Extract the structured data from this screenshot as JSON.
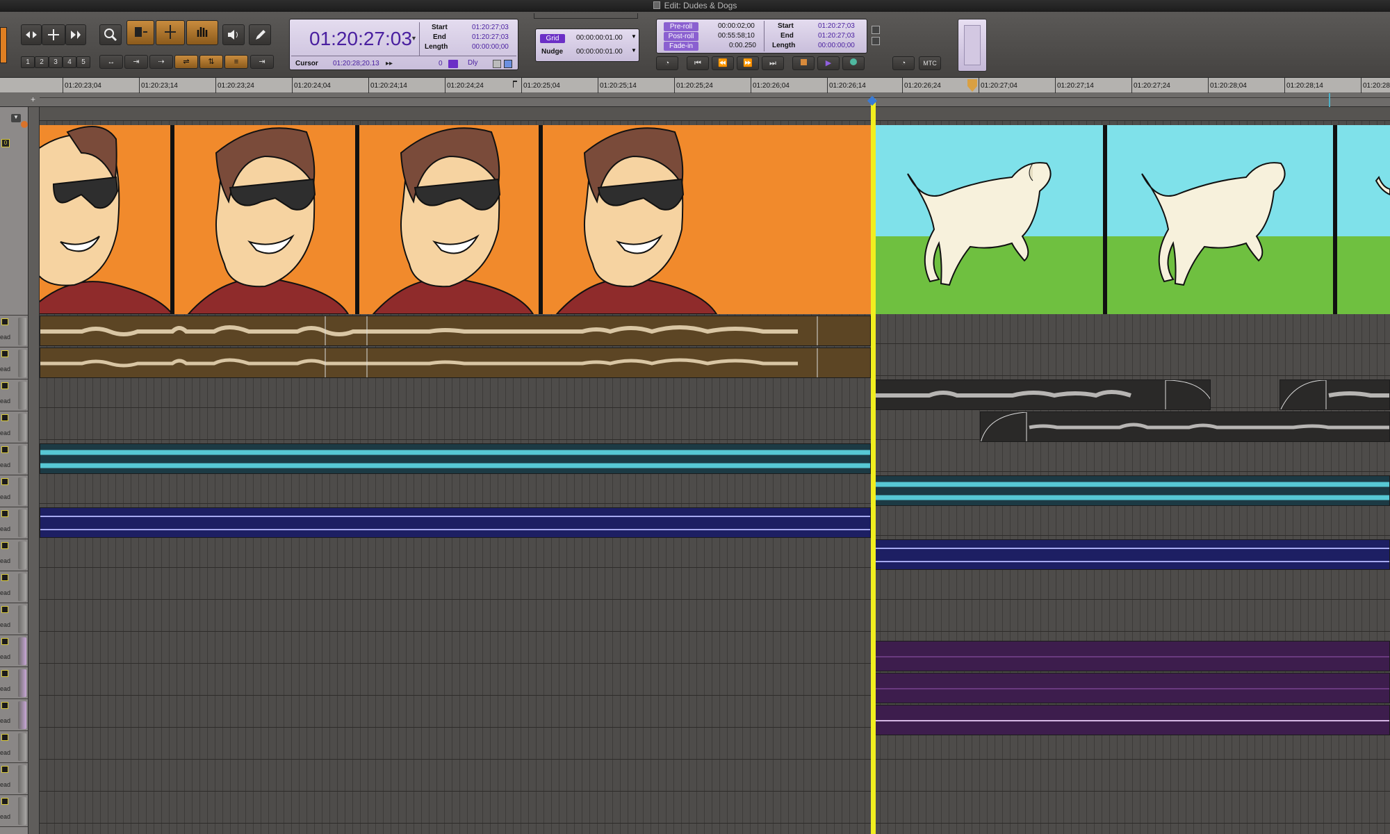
{
  "window": {
    "title": "Edit: Dudes & Dogs"
  },
  "toolbar": {
    "edit_mode_numbers": [
      "1",
      "2",
      "3",
      "4",
      "5"
    ],
    "main_counter": "01:20:27:03",
    "selection": {
      "start_label": "Start",
      "start_value": "01:20:27;03",
      "end_label": "End",
      "end_value": "01:20:27;03",
      "length_label": "Length",
      "length_value": "00:00:00;00"
    },
    "cursor": {
      "label": "Cursor",
      "value": "01:20:28;20.13",
      "count": "0",
      "dly_label": "Dly"
    },
    "grid": {
      "label": "Grid",
      "value": "00:00:00:01.00"
    },
    "nudge": {
      "label": "Nudge",
      "value": "00:00:00:01.00"
    },
    "preroll": {
      "label": "Pre-roll",
      "value": "00:00:02;00"
    },
    "postroll": {
      "label": "Post-roll",
      "value": "00:55:58;10"
    },
    "fadein": {
      "label": "Fade-in",
      "value": "0:00.250"
    },
    "transport_selection": {
      "start_label": "Start",
      "start_value": "01:20:27;03",
      "end_label": "End",
      "end_value": "01:20:27;03",
      "length_label": "Length",
      "length_value": "00:00:00;00"
    },
    "mtc_label": "MTC"
  },
  "ruler": {
    "labels": [
      "01:20:23;04",
      "01:20:23;14",
      "01:20:23;24",
      "01:20:24;04",
      "01:20:24;14",
      "01:20:24;24",
      "01:20:25;04",
      "01:20:25;14",
      "01:20:25;24",
      "01:20:26;04",
      "01:20:26;14",
      "01:20:26;24",
      "01:20:27;04",
      "01:20:27;14",
      "01:20:27;24",
      "01:20:28;04",
      "01:20:28;14",
      "01:20:28;"
    ]
  },
  "track_headers": {
    "read_label": "ead"
  },
  "colors": {
    "playhead": "#f1ee1f",
    "video_clip_dude_bg": "#f18a2c",
    "video_clip_dog_bg": "#7fe1ea",
    "audio_dialog_clip": "#5c4524",
    "audio_dog_clip": "#2a2928",
    "music_clip": "#1c3a44",
    "aux_clip_blue": "#1d1f63",
    "aux_clip_purple": "#3d1d4d"
  },
  "icons": [
    "document-icon",
    "zoom-icon",
    "trim-icon",
    "select-icon",
    "grabber-icon",
    "scrubber-icon",
    "pencil-icon",
    "speaker-icon",
    "rewind-icon",
    "fast-forward-icon",
    "go-to-start-icon",
    "go-to-end-icon",
    "stop-icon",
    "play-icon",
    "record-icon",
    "online-icon"
  ]
}
